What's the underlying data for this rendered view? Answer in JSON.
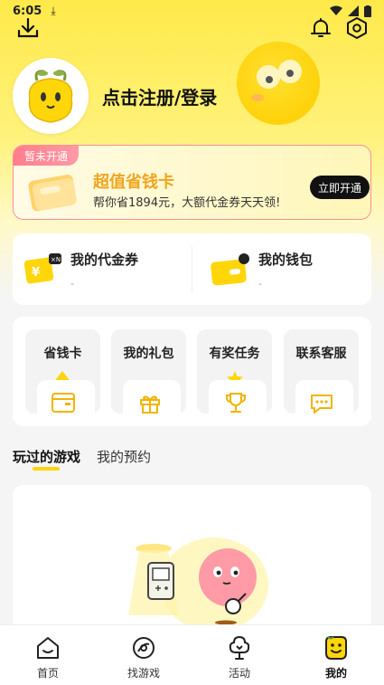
{
  "status_bar": {
    "time": "6:05"
  },
  "header": {
    "download_icon": "download-icon",
    "bell_icon": "bell-icon",
    "settings_icon": "hexagon-settings-icon"
  },
  "profile": {
    "login_text": "点击注册/登录"
  },
  "vip_card": {
    "badge": "暂未开通",
    "title": "超值省钱卡",
    "subtitle": "帮你省1894元，大额代金券天天领!",
    "button": "立即开通",
    "card_tag": "省钱卡"
  },
  "wallet": {
    "coupons": {
      "label": "我的代金券",
      "value": "-",
      "badge": "×N"
    },
    "purse": {
      "label": "我的钱包",
      "value": "-"
    }
  },
  "grid": [
    {
      "label": "省钱卡",
      "icon": "wallet-icon"
    },
    {
      "label": "我的礼包",
      "icon": "gift-icon"
    },
    {
      "label": "有奖任务",
      "icon": "trophy-icon"
    },
    {
      "label": "联系客服",
      "icon": "chat-icon"
    }
  ],
  "tabs": [
    {
      "label": "玩过的游戏",
      "active": true
    },
    {
      "label": "我的预约",
      "active": false
    }
  ],
  "bottom_nav": [
    {
      "label": "首页",
      "icon": "home-icon"
    },
    {
      "label": "找游戏",
      "icon": "game-disc-icon"
    },
    {
      "label": "活动",
      "icon": "activity-tree-icon"
    },
    {
      "label": "我的",
      "icon": "profile-icon",
      "active": true
    }
  ],
  "colors": {
    "accent": "#ffd60a",
    "vip_title": "#f0a51e",
    "vip_border": "#ff8c9a"
  }
}
